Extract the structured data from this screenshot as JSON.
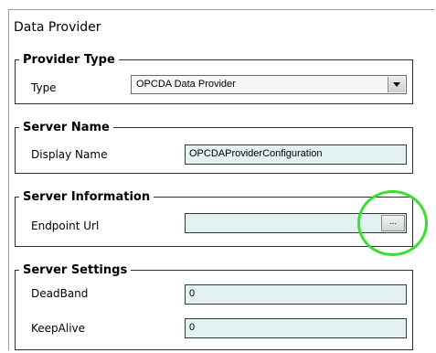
{
  "page": {
    "title": "Data Provider"
  },
  "groups": {
    "provider_type": {
      "legend": "Provider Type",
      "type_label": "Type",
      "type_value": "OPCDA Data Provider"
    },
    "server_name": {
      "legend": "Server Name",
      "display_name_label": "Display Name",
      "display_name_value": "OPCDAProviderConfiguration"
    },
    "server_information": {
      "legend": "Server Information",
      "endpoint_label": "Endpoint Url",
      "endpoint_value": "",
      "browse_label": "..."
    },
    "server_settings": {
      "legend": "Server Settings",
      "deadband_label": "DeadBand",
      "deadband_value": "0",
      "keepalive_label": "KeepAlive",
      "keepalive_value": "0"
    }
  },
  "annotation": {
    "color": "#37e02f"
  }
}
